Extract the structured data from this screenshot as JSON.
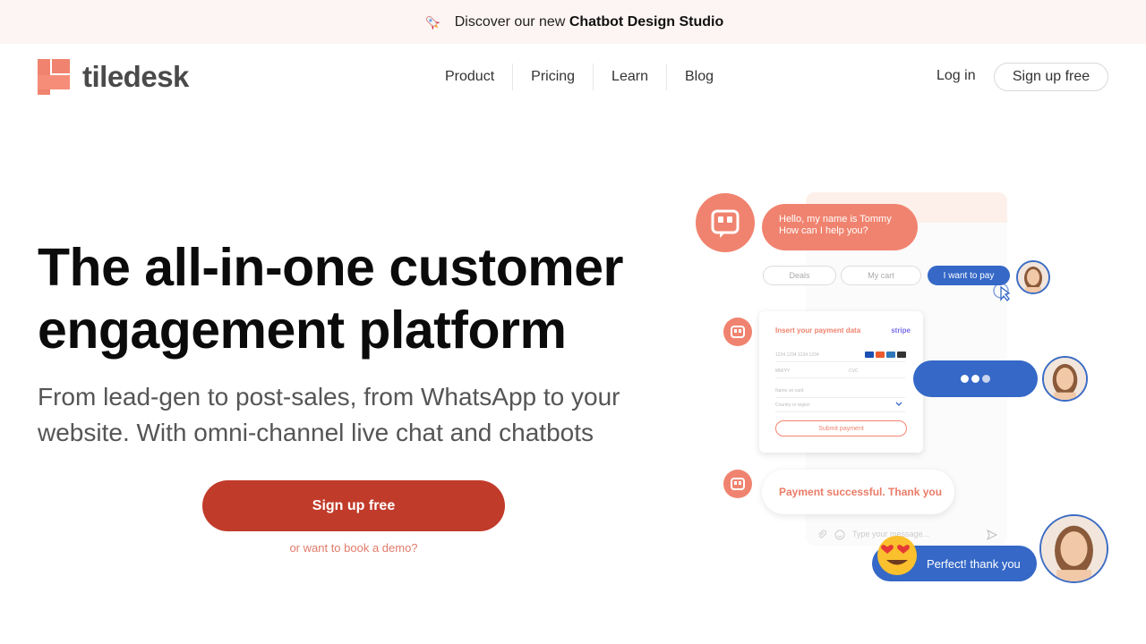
{
  "announcement": {
    "prefix": "Discover our new",
    "highlight": "Chatbot Design Studio"
  },
  "brand": {
    "name": "tiledesk",
    "accent": "#f0836f",
    "cta_color": "#c13b2a",
    "blue": "#3568c7"
  },
  "nav": {
    "items": [
      {
        "label": "Product"
      },
      {
        "label": "Pricing"
      },
      {
        "label": "Learn"
      },
      {
        "label": "Blog"
      }
    ],
    "login": "Log in",
    "signup": "Sign up free"
  },
  "hero": {
    "title_line1": "The all-in-one customer",
    "title_line2": "engagement platform",
    "subtitle_line1": "From lead-gen to post-sales, from WhatsApp to your",
    "subtitle_line2": "website. With omni-channel live chat and chatbots",
    "cta": "Sign up free",
    "demo_link": "or want to book a demo?"
  },
  "illustration": {
    "bot_greeting_line1": "Hello, my name is Tommy",
    "bot_greeting_line2": "How can I help you?",
    "chips": [
      "Deals",
      "My cart",
      "I want to pay"
    ],
    "payment": {
      "title": "Insert your payment data",
      "provider": "stripe",
      "card_placeholder": "1234 1234 1234 1234",
      "expiry_placeholder": "MM/YY",
      "cvc_placeholder": "CVC",
      "name_placeholder": "Name on card",
      "country_placeholder": "Country or region",
      "submit": "Submit payment"
    },
    "success": "Payment successful. Thank you",
    "input_placeholder": "Type your message...",
    "reply": "Perfect! thank you"
  }
}
